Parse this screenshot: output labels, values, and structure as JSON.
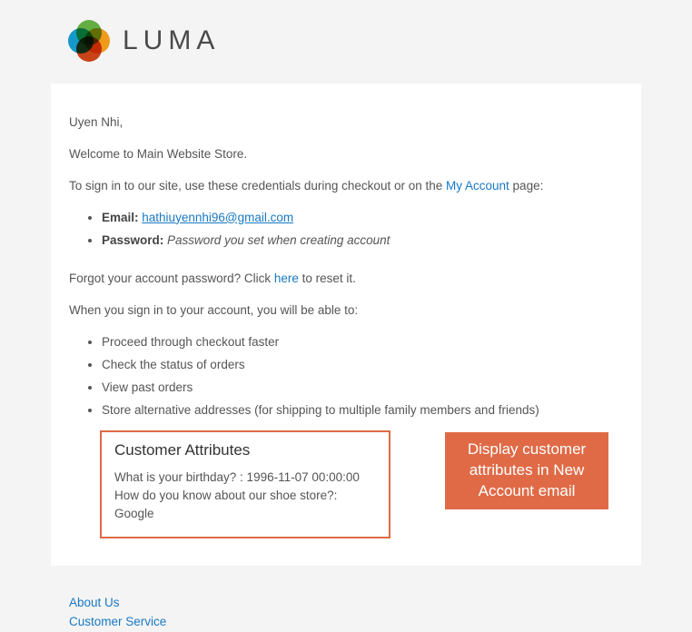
{
  "logo": {
    "text": "LUMA"
  },
  "email": {
    "greeting": "Uyen Nhi,",
    "welcome": "Welcome to Main Website Store.",
    "signin_prefix": "To sign in to our site, use these credentials during checkout or on the ",
    "myaccount_link": "My Account",
    "signin_suffix": " page:",
    "creds": {
      "email_label": "Email:",
      "email_value": "hathiuyennhi96@gmail.com",
      "password_label": "Password:",
      "password_value": "Password you set when creating account"
    },
    "forgot_prefix": "Forgot your account password? Click ",
    "forgot_link": "here",
    "forgot_suffix": " to reset it.",
    "able_intro": "When you sign in to your account, you will be able to:",
    "features": [
      "Proceed through checkout faster",
      "Check the status of orders",
      "View past orders",
      "Store alternative addresses (for shipping to multiple family members and friends)"
    ],
    "attributes": {
      "title": "Customer Attributes",
      "lines": [
        "What is your birthday? : 1996-11-07 00:00:00",
        "How do you know about our shoe store?: Google"
      ]
    },
    "callout": "Display customer attributes in New Account email"
  },
  "footer": {
    "links": [
      "About Us",
      "Customer Service"
    ]
  }
}
